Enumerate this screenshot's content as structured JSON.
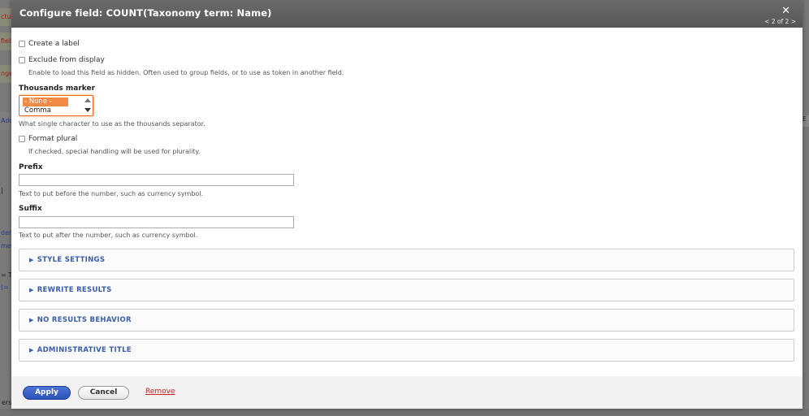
{
  "background": {
    "left_snippets": [
      "ctu",
      "fiel",
      "nge",
      "Add",
      "|",
      "den",
      "met",
      "= T",
      "(="
    ],
    "right_snippets": [
      "E"
    ],
    "bottom_text": "ers:"
  },
  "dialog": {
    "title": "Configure field: COUNT(Taxonomy term: Name)",
    "close_symbol": "✕",
    "pager": "< 2 of 2 >"
  },
  "form": {
    "create_label": "Create a label",
    "exclude_display": "Exclude from display",
    "exclude_desc": "Enable to load this field as hidden. Often used to group fields, or to use as token in another field.",
    "thousands_title": "Thousands marker",
    "thousands_options": [
      "- None -",
      "Comma"
    ],
    "thousands_desc": "What single character to use as the thousands separator.",
    "format_plural": "Format plural",
    "format_plural_desc": "If checked, special handling will be used for plurality.",
    "prefix_title": "Prefix",
    "prefix_value": "",
    "prefix_desc": "Text to put before the number, such as currency symbol.",
    "suffix_title": "Suffix",
    "suffix_value": "",
    "suffix_desc": "Text to put after the number, such as currency symbol."
  },
  "sections": [
    {
      "label": "STYLE SETTINGS"
    },
    {
      "label": "REWRITE RESULTS"
    },
    {
      "label": "NO RESULTS BEHAVIOR"
    },
    {
      "label": "ADMINISTRATIVE TITLE"
    }
  ],
  "footer": {
    "apply": "Apply",
    "cancel": "Cancel",
    "remove": "Remove"
  },
  "colors": {
    "accent_blue": "#2b52b8",
    "select_highlight": "#f08a44",
    "remove_red": "#cc2222"
  }
}
